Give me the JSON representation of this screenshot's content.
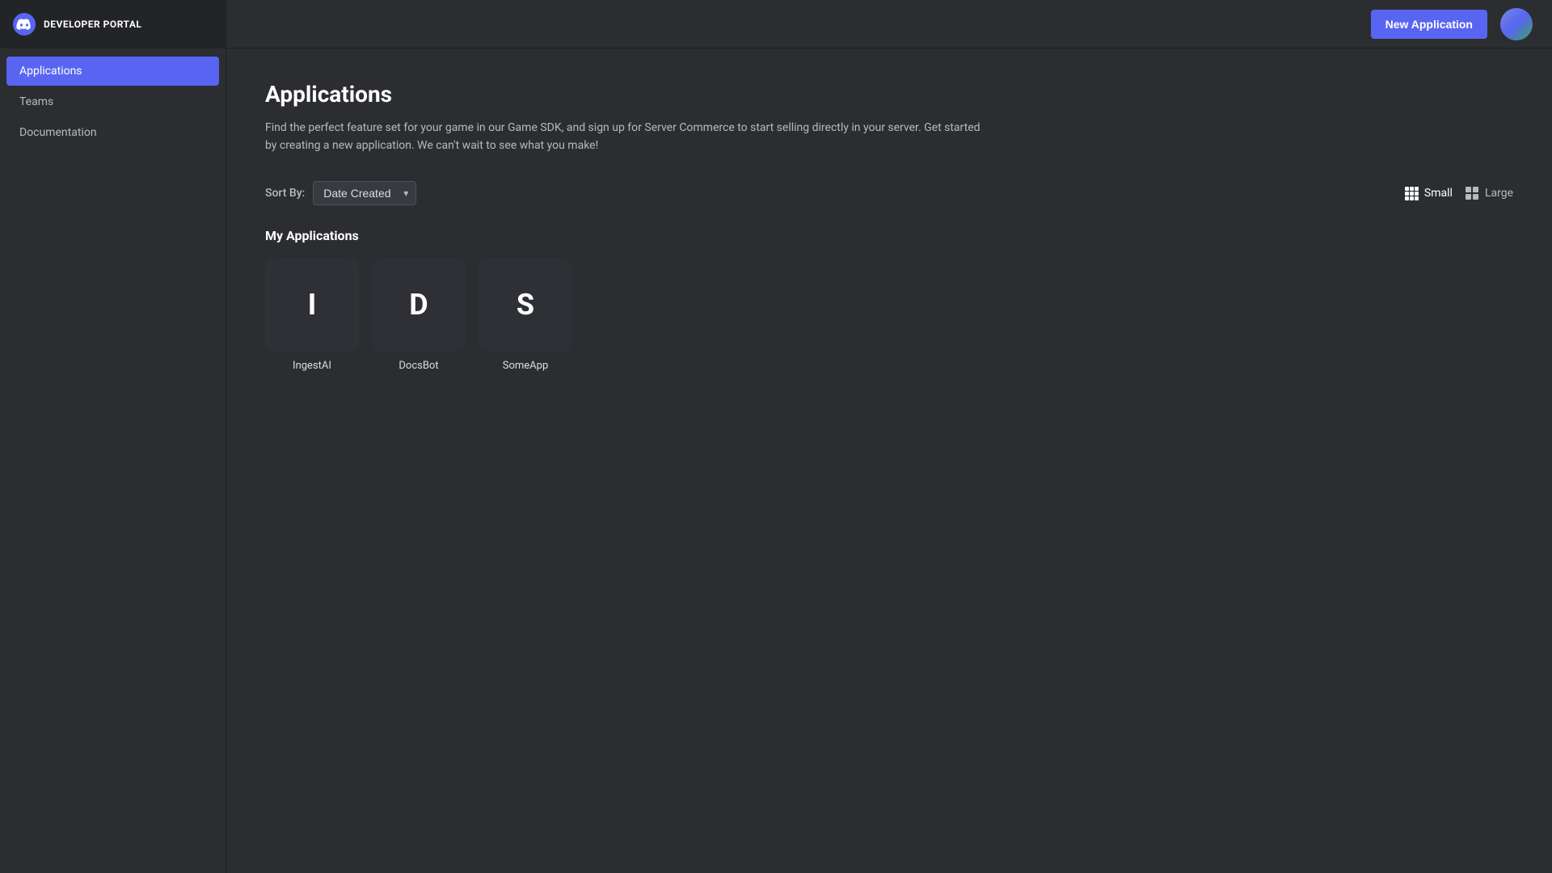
{
  "sidebar": {
    "brand": "DEVELOPER PORTAL",
    "items": [
      {
        "id": "applications",
        "label": "Applications",
        "active": true
      },
      {
        "id": "teams",
        "label": "Teams",
        "active": false
      },
      {
        "id": "documentation",
        "label": "Documentation",
        "active": false
      }
    ]
  },
  "topbar": {
    "new_app_label": "New Application"
  },
  "content": {
    "page_title": "Applications",
    "description": "Find the perfect feature set for your game in our Game SDK, and sign up for Server Commerce to start selling directly in your server. Get started by creating a new application. We can't wait to see what you make!",
    "sort_by_label": "Sort By:",
    "sort_options": [
      {
        "value": "date_created",
        "label": "Date Created"
      }
    ],
    "sort_selected": "Date Created",
    "view_options": [
      {
        "id": "small",
        "label": "Small",
        "active": true
      },
      {
        "id": "large",
        "label": "Large",
        "active": false
      }
    ],
    "my_applications_title": "My Applications",
    "applications": [
      {
        "id": "ingest-ai",
        "initial": "I",
        "name": "IngestAI"
      },
      {
        "id": "docsbot",
        "initial": "D",
        "name": "DocsBot"
      },
      {
        "id": "someapp",
        "initial": "S",
        "name": "SomeApp"
      }
    ]
  }
}
